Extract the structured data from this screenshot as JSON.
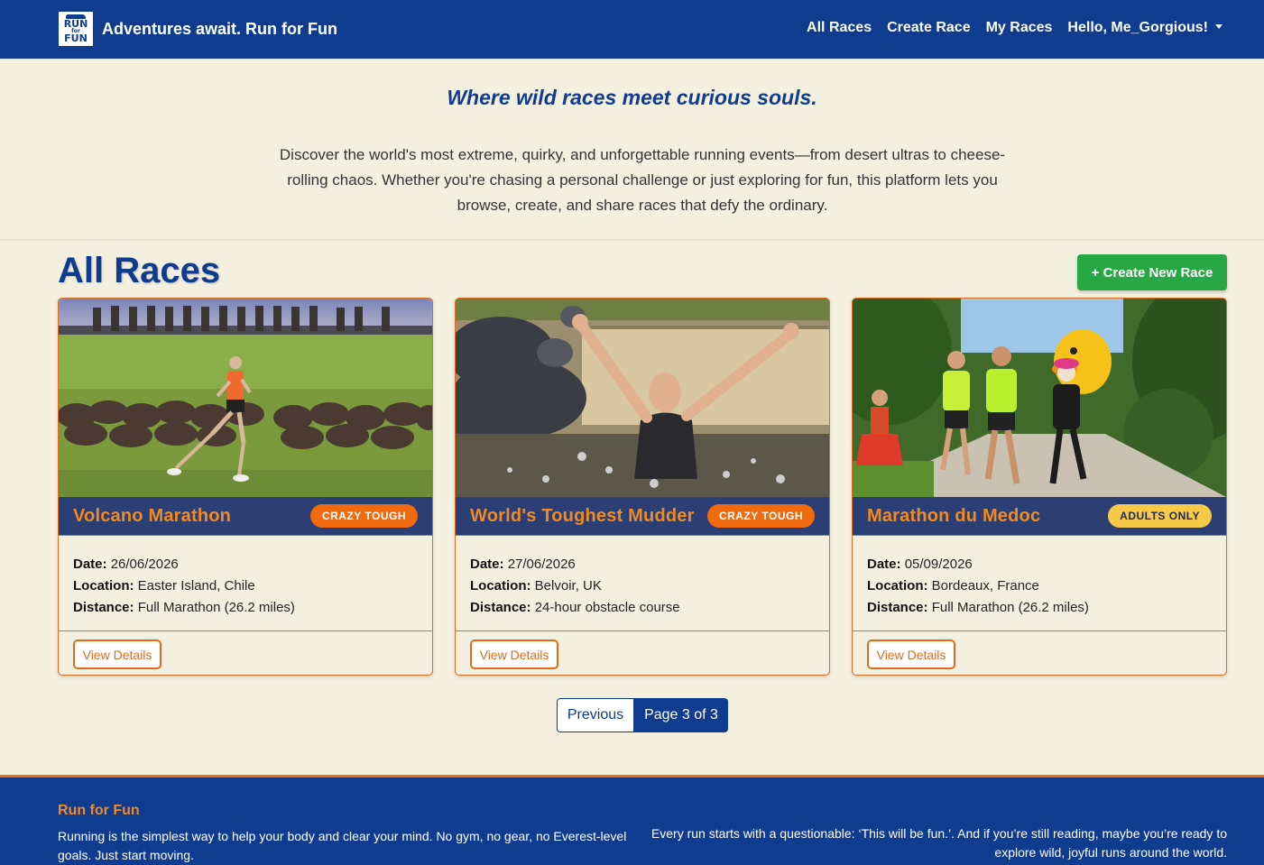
{
  "nav": {
    "logo_text": [
      "RUN",
      "for",
      "FUN"
    ],
    "brand": "Adventures await. Run for Fun",
    "links": [
      "All Races",
      "Create Race",
      "My Races"
    ],
    "user": "Hello, Me_Gorgious!"
  },
  "hero": {
    "tagline": "Where wild races meet curious souls.",
    "description": "Discover the world's most extreme, quirky, and unforgettable running events—from desert ultras to cheese-rolling chaos. Whether you're chasing a personal challenge or just exploring for fun, this platform lets you browse, create, and share races that defy the ordinary."
  },
  "section": {
    "title": "All Races",
    "create_button": "+ Create New Race"
  },
  "labels": {
    "date": "Date:",
    "location": "Location:",
    "distance": "Distance:",
    "details_button": "View Details"
  },
  "races": [
    {
      "title": "Volcano Marathon",
      "badge": "CRAZY TOUGH",
      "date": "26/06/2026",
      "location": "Easter Island, Chile",
      "distance": "Full Marathon (26.2 miles)"
    },
    {
      "title": "World's Toughest Mudder",
      "badge": "CRAZY TOUGH",
      "date": "27/06/2026",
      "location": "Belvoir, UK",
      "distance": "24-hour obstacle course"
    },
    {
      "title": "Marathon du Medoc",
      "badge": "ADULTS ONLY",
      "date": "05/09/2026",
      "location": "Bordeaux, France",
      "distance": "Full Marathon (26.2 miles)"
    }
  ],
  "pagination": {
    "previous": "Previous",
    "current": "Page 3 of 3"
  },
  "footer": {
    "title": "Run for Fun",
    "left": "Running is the simplest way to help your body and clear your mind. No gym, no gear, no Everest-level goals. Just start moving.",
    "right": "Every run starts with a questionable: ‘This will be fun.’. And if you’re still reading, maybe you’re ready to explore wild, joyful runs around the world."
  },
  "colors": {
    "navy": "#0f3c8f",
    "orange": "#f06a0f",
    "green": "#28a745",
    "cream": "#f4f0e0",
    "badge_yellow": "#f7c948"
  }
}
